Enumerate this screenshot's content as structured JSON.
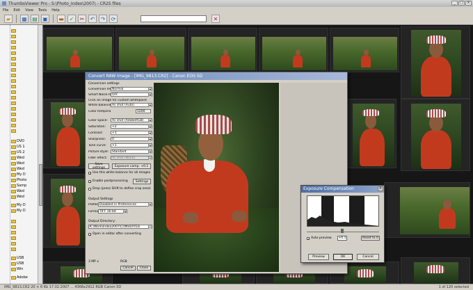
{
  "app": {
    "title": "ThumbsViewer Pro - S:\\Photo_Index\\2007\\ - CR2S files",
    "menu": [
      "File",
      "Edit",
      "View",
      "Tools",
      "Help"
    ],
    "window_buttons": [
      "_",
      "□",
      "×"
    ]
  },
  "toolbar": {
    "icons": [
      "folder-open-icon",
      "grid-view-icon",
      "list-view-icon",
      "slideshow-icon",
      "print-icon",
      "check-icon",
      "scissors-icon",
      "rotate-left-icon",
      "rotate-right-icon",
      "refresh-icon",
      "delete-icon"
    ]
  },
  "tree": {
    "items": [
      "DVD",
      "US 1",
      "US 2",
      "Wed",
      "Wed",
      "Wed",
      "My D",
      "Photo",
      "Samp",
      "Wed",
      "Wed",
      "My D",
      "My D",
      "USB",
      "USB",
      "Win",
      "Adobe"
    ]
  },
  "raw_dialog": {
    "title": "Convert RAW Image - [IMG_9813.CR2] - Canon EOS 5D",
    "section": "Conversion settings",
    "rows": [
      {
        "label": "Conversion method:",
        "value": "Normal"
      },
      {
        "label": "Smart Noise Reduction:",
        "value": "OFF"
      },
      {
        "label": "Click an image for custom whitepoint",
        "value": ""
      },
      {
        "label": "White balance:",
        "value": "As shot (Auto)"
      },
      {
        "label": "Color temperature:",
        "value": "5200"
      },
      {
        "label": "Color space:",
        "value": "As shot (AdobeRGB)"
      },
      {
        "label": "Saturation:",
        "value": "+2"
      },
      {
        "label": "Contrast:",
        "value": "+1"
      },
      {
        "label": "Sharpness:",
        "value": "0"
      },
      {
        "label": "Tone curve:",
        "value": "+1"
      },
      {
        "label": "Picture style:",
        "value": "Standard"
      },
      {
        "label": "Filter effect:",
        "value": "As shot (None)"
      }
    ],
    "save_settings": "Save settings",
    "exposure_comp": "Exposure comp. +0.1",
    "use_wb_all": "Use this white balance for all images",
    "enable_postprocessing": "Enable postprocessing",
    "settings_btn": "Settings",
    "drop_space": "Drop (press Shift to define crop area)",
    "output_section": "Output Settings",
    "profile_label": "Profile:",
    "profile_value": "Disabled in Preferences",
    "format_label": "Format:",
    "format_value": "TIFF 16-bit",
    "output_dir_label": "Output Directory:",
    "output_dir_value": "K:\\Work\\Index2007\\CONVERTED",
    "open_in_editor": "Open in editor after converting",
    "info_size": "3 MP x",
    "info_mode": "RGB",
    "cancel": "Cancel",
    "close": "Close"
  },
  "exposure_dialog": {
    "title": "Exposure Compensation",
    "auto_preview": "Auto preview",
    "value": "+0.1",
    "reset": "Reset to 0",
    "preview": "Preview",
    "ok": "OK",
    "cancel": "Cancel"
  },
  "status": {
    "left": "IMG_9813.CR2  20 × 6 Kb  17.02.2007 ...  4368x2912  RGB  Canon 5D",
    "right": "1 of 120 selected"
  }
}
